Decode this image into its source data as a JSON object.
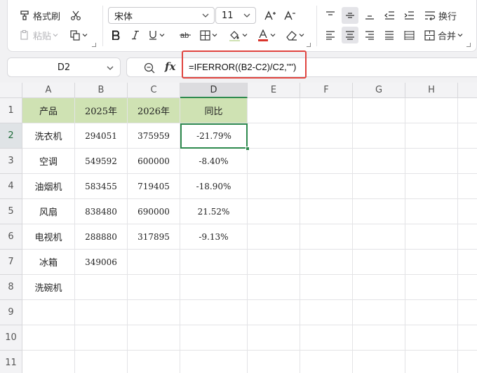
{
  "ribbon": {
    "format_painter_label": "格式刷",
    "paste_label": "粘贴",
    "font_name": "宋体",
    "font_size": "11",
    "wrap_label": "换行",
    "merge_label": "合并"
  },
  "formula_bar": {
    "name_box": "D2",
    "fx_label": "fx",
    "formula": "=IFERROR((B2-C2)/C2,\"\")"
  },
  "columns": [
    "A",
    "B",
    "C",
    "D",
    "E",
    "F",
    "G",
    "H"
  ],
  "rows": [
    "1",
    "2",
    "3",
    "4",
    "5",
    "6",
    "7",
    "8",
    "9",
    "10",
    "11"
  ],
  "table": {
    "headers": [
      "产品",
      "2025年",
      "2026年",
      "同比"
    ],
    "rows": [
      [
        "洗衣机",
        "294051",
        "375959",
        "-21.79%"
      ],
      [
        "空调",
        "549592",
        "600000",
        "-8.40%"
      ],
      [
        "油烟机",
        "583455",
        "719405",
        "-18.90%"
      ],
      [
        "风扇",
        "838480",
        "690000",
        "21.52%"
      ],
      [
        "电视机",
        "288880",
        "317895",
        "-9.13%"
      ],
      [
        "冰箱",
        "349006",
        "",
        ""
      ],
      [
        "洗碗机",
        "",
        "",
        ""
      ]
    ]
  },
  "colors": {
    "header_fill": "#cfe2b3",
    "active_border": "#2e8a4e",
    "highlight_box": "#e0443f",
    "font_color_bar": "#d9342b"
  }
}
